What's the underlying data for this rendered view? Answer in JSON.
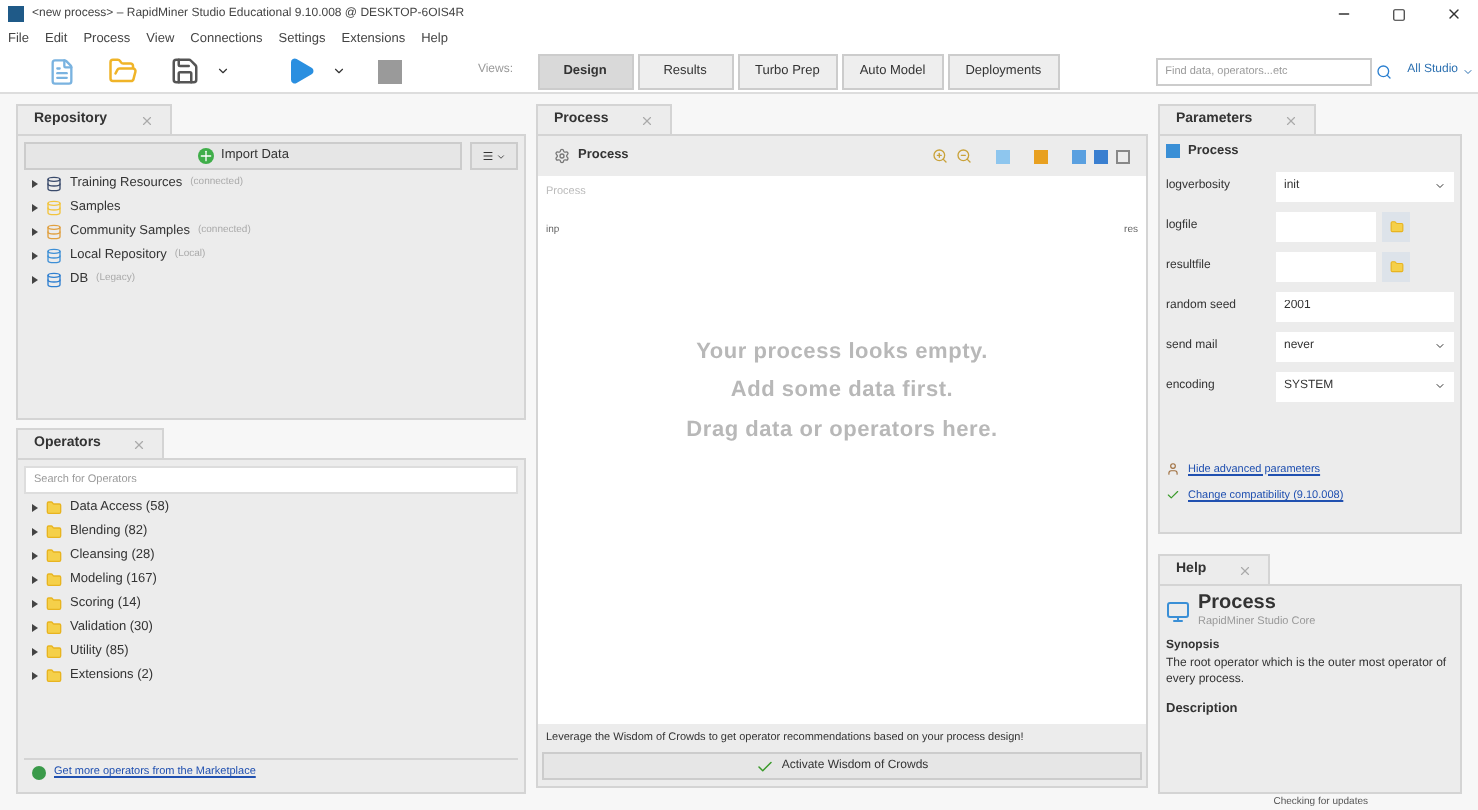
{
  "window": {
    "title": "<new process> – RapidMiner Studio Educational 9.10.008 @ DESKTOP-6OIS4R"
  },
  "menu": [
    "File",
    "Edit",
    "Process",
    "View",
    "Connections",
    "Settings",
    "Extensions",
    "Help"
  ],
  "toolbar": {
    "views_label": "Views:",
    "views": [
      {
        "label": "Design",
        "selected": true
      },
      {
        "label": "Results",
        "selected": false
      },
      {
        "label": "Turbo Prep",
        "selected": false
      },
      {
        "label": "Auto Model",
        "selected": false
      },
      {
        "label": "Deployments",
        "selected": false
      }
    ],
    "search_placeholder": "Find data, operators...etc",
    "scope": "All Studio"
  },
  "repository": {
    "tab": "Repository",
    "import_button": "Import Data",
    "items": [
      {
        "name": "Training Resources",
        "note": "(connected)",
        "color": "#3a4a6b"
      },
      {
        "name": "Samples",
        "color": "#f2c43d"
      },
      {
        "name": "Community Samples",
        "note": "(connected)",
        "color": "#e0a040"
      },
      {
        "name": "Local Repository",
        "note": "(Local)",
        "color": "#3d8fd6"
      },
      {
        "name": "DB",
        "note": "(Legacy)",
        "color": "#2f7fd0"
      }
    ]
  },
  "operators": {
    "tab": "Operators",
    "search_placeholder": "Search for Operators",
    "items": [
      "Data Access (58)",
      "Blending (82)",
      "Cleansing (28)",
      "Modeling (167)",
      "Scoring (14)",
      "Validation (30)",
      "Utility (85)",
      "Extensions (2)"
    ],
    "marketplace_link": "Get more operators from the Marketplace"
  },
  "process": {
    "tab": "Process",
    "breadcrumb": "Process",
    "canvas_label": "Process",
    "port_in": "inp",
    "port_out": "res",
    "empty_lines": [
      "Your process looks empty.",
      "Add some data first.",
      "Drag data or operators here."
    ],
    "wisdom_text": "Leverage the Wisdom of Crowds to get operator recommendations based on your process design!",
    "wisdom_button": "Activate Wisdom of Crowds"
  },
  "parameters": {
    "tab": "Parameters",
    "header": "Process",
    "rows": [
      {
        "label": "logverbosity",
        "kind": "select",
        "value": "init"
      },
      {
        "label": "logfile",
        "kind": "file"
      },
      {
        "label": "resultfile",
        "kind": "file"
      },
      {
        "label": "random seed",
        "kind": "text",
        "value": "2001"
      },
      {
        "label": "send mail",
        "kind": "select",
        "value": "never"
      },
      {
        "label": "encoding",
        "kind": "select",
        "value": "SYSTEM"
      }
    ],
    "links": [
      "Hide advanced parameters",
      "Change compatibility (9.10.008)"
    ]
  },
  "help": {
    "tab": "Help",
    "title": "Process",
    "subtitle": "RapidMiner Studio Core",
    "synopsis_heading": "Synopsis",
    "synopsis": "The root operator which is the outer most operator of every process.",
    "description_heading": "Description"
  },
  "status": "Checking for updates"
}
